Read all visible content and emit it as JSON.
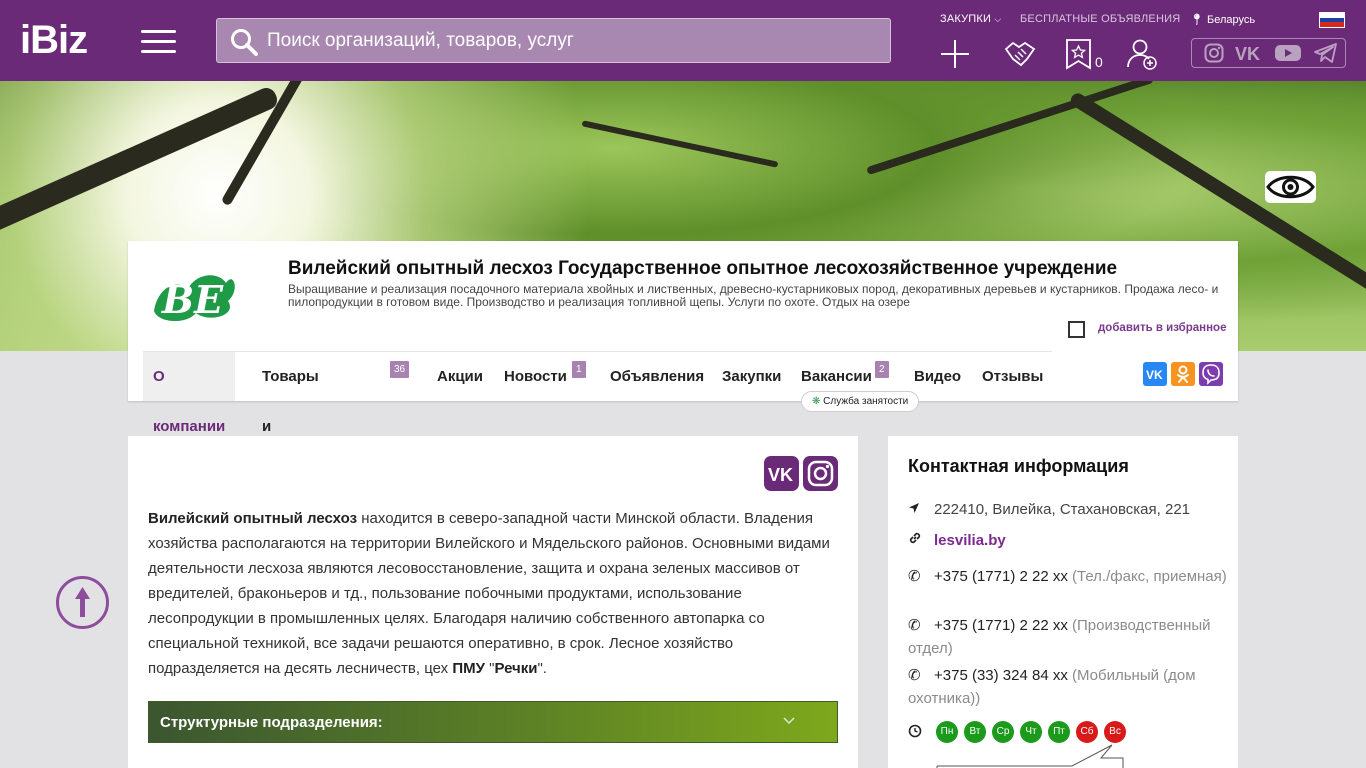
{
  "header": {
    "logo": "iBiz",
    "search_placeholder": "Поиск организаций, товаров, услуг",
    "links": {
      "procurement": "ЗАКУПКИ",
      "free_ads": "БЕСПЛАТНЫЕ ОБЪЯВЛЕНИЯ",
      "region": "Беларусь"
    },
    "favorites_count": "0"
  },
  "company": {
    "title": "Вилейский опытный лесхоз Государственное опытное лесохозяйственное учреждение",
    "description": "Выращивание и реализация посадочного материала хвойных и лиственных, древесно-кустарниковых пород, декоративных деревьев и кустарников. Продажа лесо- и пилопродукции в готовом виде. Производство и реализация топливной щепы. Услуги по охоте. Отдых на озере",
    "add_favorite": "добавить в избранное",
    "logo_text": "ВЕ"
  },
  "tabs": [
    {
      "label": "О компании",
      "badge": ""
    },
    {
      "label": "Товары и услуги",
      "badge": "36"
    },
    {
      "label": "Акции",
      "badge": ""
    },
    {
      "label": "Новости",
      "badge": "1"
    },
    {
      "label": "Объявления",
      "badge": ""
    },
    {
      "label": "Закупки",
      "badge": ""
    },
    {
      "label": "Вакансии",
      "badge": "2"
    },
    {
      "label": "Видео",
      "badge": ""
    },
    {
      "label": "Отзывы",
      "badge": ""
    }
  ],
  "employment_tag": "Служба занятости",
  "about": {
    "name": "Вилейский опытный лесхоз",
    "text": " находится в северо-западной части Минской области. Владения хозяйства располагаются на территории Вилейского и Мядельского районов. Основными видами деятельности лесхоза являются лесовосстановление, защита и охрана зеленых массивов от вредителей, браконьеров и тд., пользование побочными продуктами, использование лесопродукции в промышленных целях. Благодаря наличию собственного автопарка со специальной техникой, все задачи решаются оперативно, в срок. Лесное хозяйство подразделяется на десять лесничеств, цех ",
    "pmu": "ПМУ",
    "quote_open": " \"",
    "rechki": "Речки",
    "quote_close": "\"."
  },
  "accordion": {
    "label": "Структурные подразделения:"
  },
  "contact": {
    "title": "Контактная информация",
    "address": "222410, Вилейка, Стахановская, 221",
    "site": "lesvilia.by",
    "phones": [
      {
        "number": "+375 (1771) 2 22 xx",
        "note": "(Тел./факс, приемная)"
      },
      {
        "number": "+375 (1771) 2 22 xx",
        "note": "(Производственный отдел)"
      },
      {
        "number": "+375 (33) 324 84 xx",
        "note": "(Мобильный (дом охотника))"
      }
    ],
    "days": [
      {
        "label": "Пн",
        "status": "open"
      },
      {
        "label": "Вт",
        "status": "open"
      },
      {
        "label": "Ср",
        "status": "open"
      },
      {
        "label": "Чт",
        "status": "open"
      },
      {
        "label": "Пт",
        "status": "open"
      },
      {
        "label": "Сб",
        "status": "closed"
      },
      {
        "label": "Вс",
        "status": "closed"
      }
    ]
  },
  "colors": {
    "header_bg": "#6a2a77",
    "accent": "#7b2a8e",
    "open_day": "#1b9a1b",
    "closed_day": "#d91a1a"
  }
}
